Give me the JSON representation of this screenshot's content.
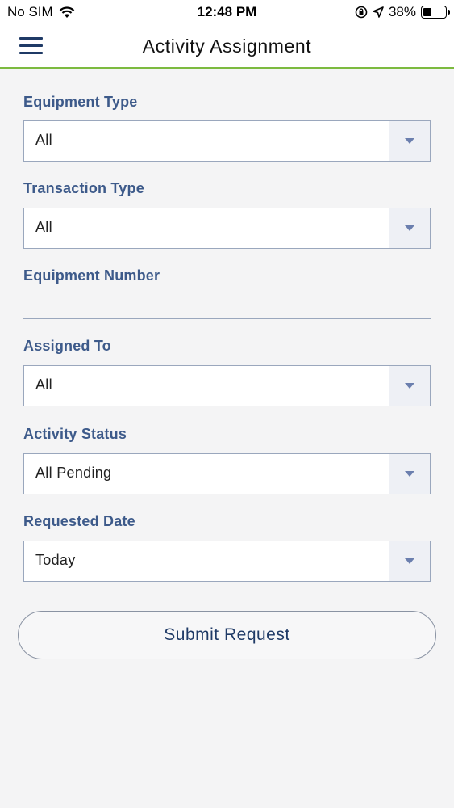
{
  "status_bar": {
    "carrier": "No SIM",
    "time": "12:48 PM",
    "battery": "38%",
    "battery_level": 0.38
  },
  "header": {
    "title": "Activity Assignment"
  },
  "form": {
    "equipment_type": {
      "label": "Equipment Type",
      "value": "All"
    },
    "transaction_type": {
      "label": "Transaction Type",
      "value": "All"
    },
    "equipment_number": {
      "label": "Equipment Number",
      "value": ""
    },
    "assigned_to": {
      "label": "Assigned To",
      "value": "All"
    },
    "activity_status": {
      "label": "Activity Status",
      "value": "All Pending"
    },
    "requested_date": {
      "label": "Requested Date",
      "value": "Today"
    },
    "submit_label": "Submit Request"
  },
  "colors": {
    "accent_green": "#7cba3f",
    "label_blue": "#3d5a8a",
    "dark_navy": "#1f3a66"
  }
}
